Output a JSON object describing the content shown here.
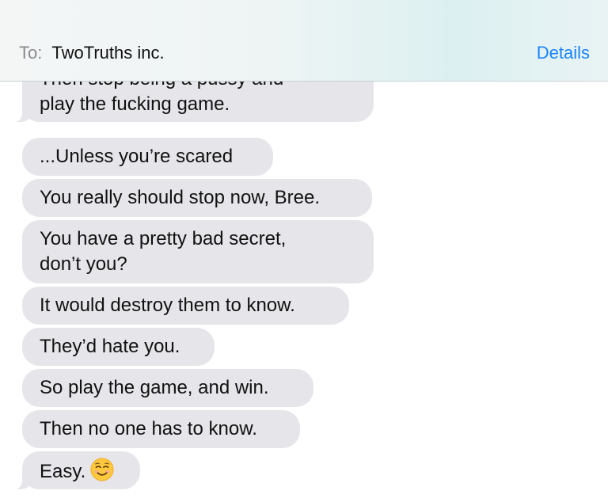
{
  "header": {
    "to_label": "To:",
    "recipient": "TwoTruths inc.",
    "details_label": "Details",
    "accent_color": "#1a82fb"
  },
  "messages": [
    {
      "lines": [
        "Then stop being a pussy and",
        "play the fucking game."
      ]
    },
    {
      "lines": [
        "...Unless you’re scared"
      ]
    },
    {
      "lines": [
        "You really should stop now, Bree."
      ]
    },
    {
      "lines": [
        "You have a pretty bad secret,",
        "don’t you?"
      ]
    },
    {
      "lines": [
        "It would destroy them to know."
      ]
    },
    {
      "lines": [
        "They’d hate you."
      ]
    },
    {
      "lines": [
        "So play the game, and win."
      ]
    },
    {
      "lines": [
        "Then no one has to know."
      ]
    },
    {
      "lines": [
        "Easy."
      ],
      "emoji": "smiling-face-emoji"
    }
  ],
  "bubble_color": "#e5e5ea"
}
